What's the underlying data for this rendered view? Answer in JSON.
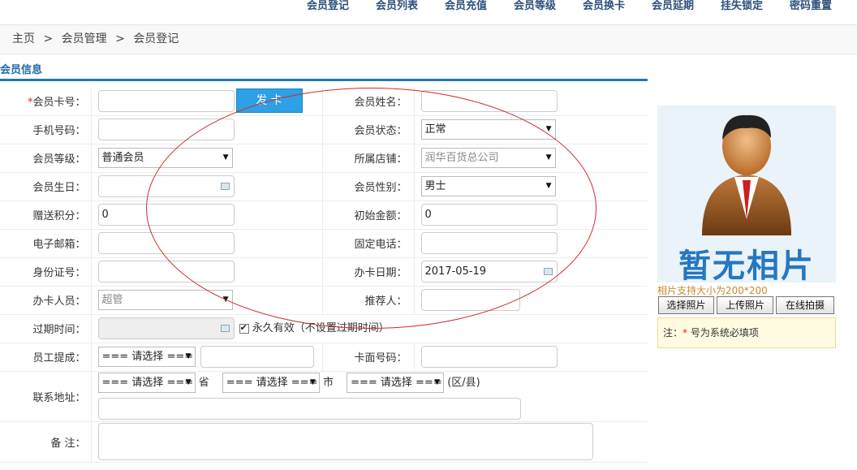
{
  "topnav": [
    "会员登记",
    "会员列表",
    "会员充值",
    "会员等级",
    "会员换卡",
    "会员延期",
    "挂失锁定",
    "密码重置"
  ],
  "breadcrumb": [
    "主页",
    ">",
    "会员管理",
    ">",
    "会员登记"
  ],
  "section_title": "会员信息",
  "labels": {
    "card_no": "会员卡号：",
    "name": "会员姓名：",
    "phone": "手机号码：",
    "status": "会员状态：",
    "level": "会员等级：",
    "store": "所属店铺：",
    "birthday": "会员生日：",
    "gender": "会员性别：",
    "points": "赠送积分：",
    "init_amount": "初始金额：",
    "email": "电子邮箱：",
    "tel": "固定电话：",
    "id_no": "身份证号：",
    "issue_date": "办卡日期：",
    "operator": "办卡人员：",
    "referrer": "推荐人：",
    "expire": "过期时间：",
    "staff_commission": "员工提成：",
    "face_no": "卡面号码：",
    "address": "联系地址：",
    "remark": "备 注："
  },
  "required_mark": "*",
  "issue_button": "发 卡",
  "values": {
    "status": "正常",
    "level": "普通会员",
    "store": "润华百货总公司",
    "gender": "男士",
    "points": "0",
    "init_amount": "0",
    "issue_date": "2017-05-19",
    "operator": "超管",
    "forever_label": "永久有效（不设置过期时间）",
    "select_placeholder": "=== 请选择 ===",
    "province_suffix": "省",
    "city_suffix": "市",
    "district_suffix": "(区/县)"
  },
  "photo": {
    "caption": "暂无相片",
    "hint": "相片支持大小为200*200",
    "buttons": [
      "选择照片",
      "上传照片",
      "在线拍摄"
    ],
    "note_prefix": "注：",
    "note_star": "*",
    "note_text": " 号为系统必填项"
  }
}
